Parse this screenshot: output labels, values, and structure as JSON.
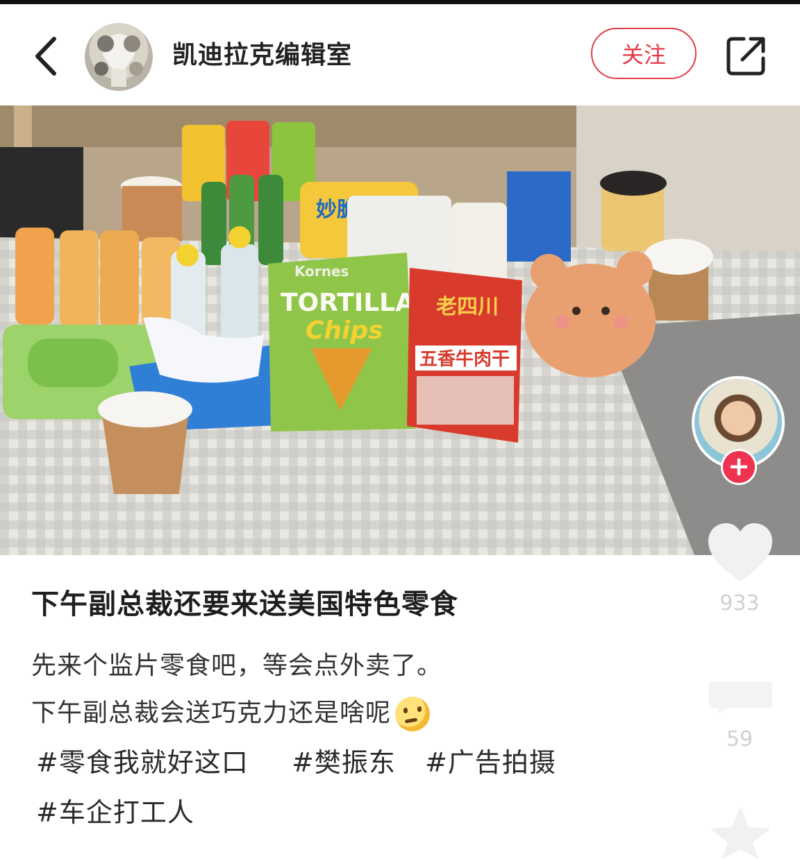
{
  "header": {
    "author_name": "凯迪拉克编辑室",
    "follow_label": "关注"
  },
  "post": {
    "title": "下午副总裁还要来送美国特色零食",
    "body_lines": [
      "先来个监片零食吧，等会点外卖了。",
      "下午副总裁会送巧克力还是啥呢"
    ],
    "hashtags": [
      "#零食我就好这口",
      "#樊振东",
      "#广告拍摄",
      "#车企打工人"
    ]
  },
  "photo_labels": {
    "chips_brand": "Kornes",
    "chips_name_1": "TORTILLA",
    "chips_name_2": "Chips",
    "jerky_brand": "老四川",
    "jerky_name": "五香牛肉干",
    "snack_bag": "妙脆角"
  },
  "sidebar": {
    "like_count": "933",
    "comment_count": "59"
  },
  "colors": {
    "accent": "#e33a48",
    "plus_badge": "#ee3350"
  }
}
